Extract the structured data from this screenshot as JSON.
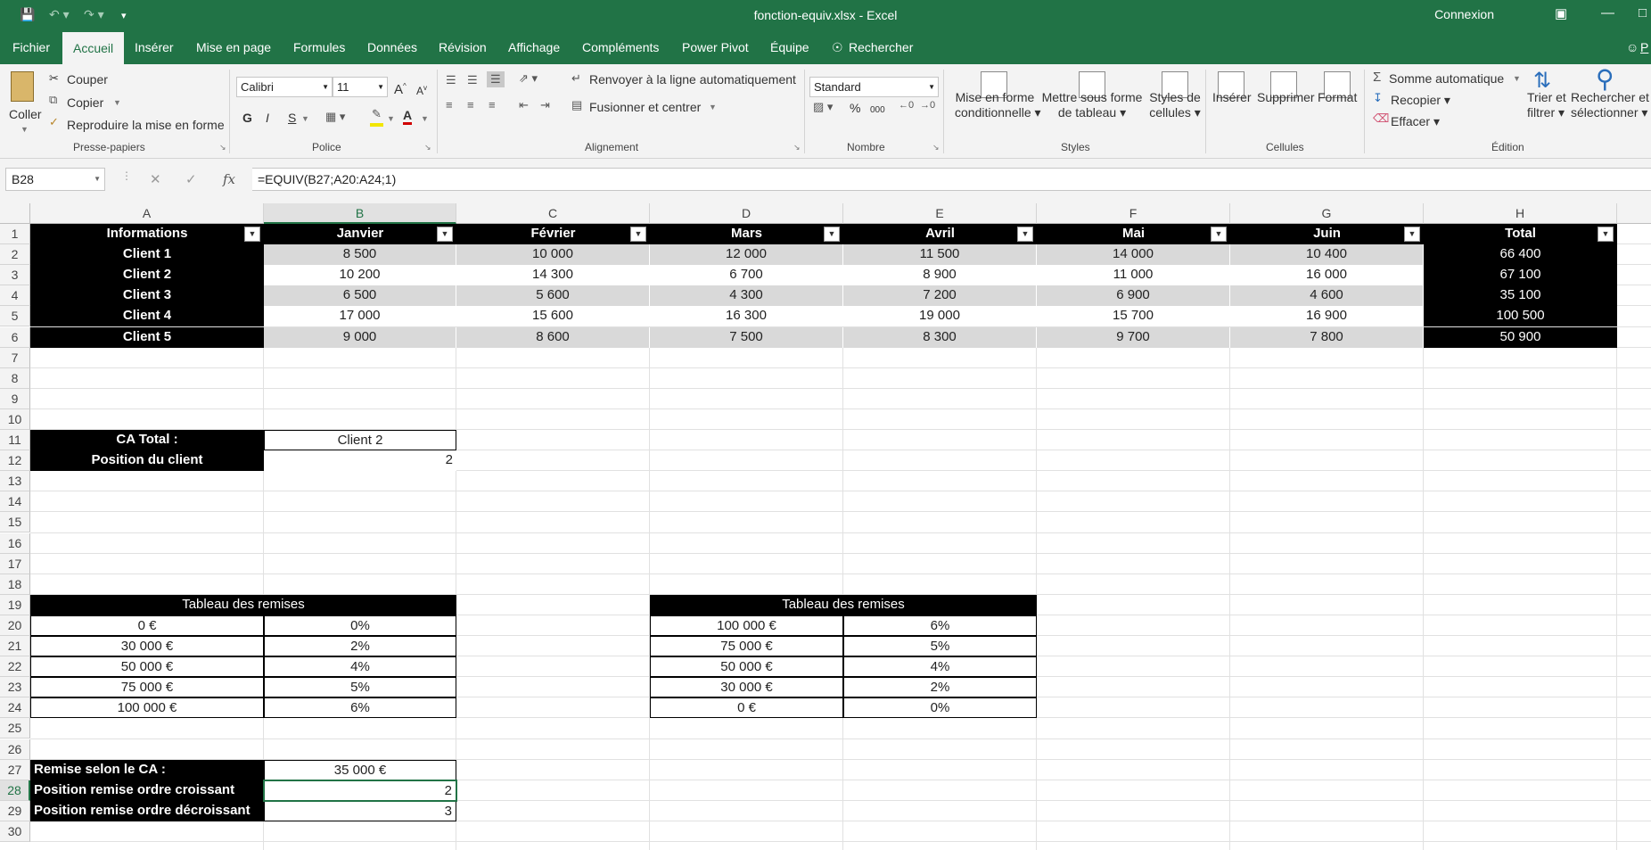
{
  "window": {
    "title": "fonction-equiv.xlsx  -  Excel",
    "signin": "Connexion"
  },
  "menu": {
    "items": [
      "Fichier",
      "Accueil",
      "Insérer",
      "Mise en page",
      "Formules",
      "Données",
      "Révision",
      "Affichage",
      "Compléments",
      "Power Pivot",
      "Équipe",
      "Rechercher"
    ],
    "active": "Accueil",
    "share": "P"
  },
  "ribbon": {
    "clipboard": {
      "paste": "Coller",
      "cut": "Couper",
      "copy": "Copier",
      "format_painter": "Reproduire la mise en forme",
      "label": "Presse-papiers"
    },
    "font": {
      "name": "Calibri",
      "size": "11",
      "label": "Police",
      "grow": "A",
      "shrink": "A",
      "bold": "G",
      "italic": "I",
      "underline": "S",
      "color": "A"
    },
    "alignment": {
      "wrap": "Renvoyer à la ligne automatiquement",
      "merge": "Fusionner et centrer",
      "label": "Alignement"
    },
    "number": {
      "format": "Standard",
      "label": "Nombre",
      "percent": "%",
      "thousands": "000"
    },
    "styles": {
      "cond_l1": "Mise en forme",
      "cond_l2": "conditionnelle",
      "table_l1": "Mettre sous forme",
      "table_l2": "de tableau",
      "cell_l1": "Styles de",
      "cell_l2": "cellules",
      "label": "Styles"
    },
    "cells": {
      "insert": "Insérer",
      "delete": "Supprimer",
      "format": "Format",
      "label": "Cellules"
    },
    "editing": {
      "autosum": "Somme automatique",
      "fill": "Recopier",
      "clear": "Effacer",
      "sort_l1": "Trier et",
      "sort_l2": "filtrer",
      "find_l1": "Rechercher et",
      "find_l2": "sélectionner",
      "label": "Édition"
    }
  },
  "formula_bar": {
    "name_box": "B28",
    "formula": "=EQUIV(B27;A20:A24;1)",
    "fx": "fx"
  },
  "columns": [
    "A",
    "B",
    "C",
    "D",
    "E",
    "F",
    "G",
    "H"
  ],
  "rows": [
    "1",
    "2",
    "3",
    "4",
    "5",
    "6",
    "7",
    "8",
    "9",
    "10",
    "11",
    "12",
    "13",
    "14",
    "15",
    "16",
    "17",
    "18",
    "19",
    "20",
    "21",
    "22",
    "23",
    "24",
    "25",
    "26",
    "27",
    "28",
    "29",
    "30"
  ],
  "selected_cell": {
    "column": "B",
    "row": "28"
  },
  "sales_table": {
    "headers": [
      "Informations",
      "Janvier",
      "Février",
      "Mars",
      "Avril",
      "Mai",
      "Juin",
      "Total"
    ],
    "rows": [
      [
        "Client 1",
        "8 500",
        "10 000",
        "12 000",
        "11 500",
        "14 000",
        "10 400",
        "66 400"
      ],
      [
        "Client 2",
        "10 200",
        "14 300",
        "6 700",
        "8 900",
        "11 000",
        "16 000",
        "67 100"
      ],
      [
        "Client 3",
        "6 500",
        "5 600",
        "4 300",
        "7 200",
        "6 900",
        "4 600",
        "35 100"
      ],
      [
        "Client 4",
        "17 000",
        "15 600",
        "16 300",
        "19 000",
        "15 700",
        "16 900",
        "100 500"
      ],
      [
        "Client 5",
        "9 000",
        "8 600",
        "7 500",
        "8 300",
        "9 700",
        "7 800",
        "50 900"
      ]
    ]
  },
  "lookup": {
    "ca_label": "CA Total :",
    "ca_value": "Client 2",
    "pos_label": "Position du client",
    "pos_value": "2"
  },
  "discount_asc": {
    "title": "Tableau des remises",
    "rows": [
      [
        "0 €",
        "0%"
      ],
      [
        "30 000 €",
        "2%"
      ],
      [
        "50 000 €",
        "4%"
      ],
      [
        "75 000 €",
        "5%"
      ],
      [
        "100 000 €",
        "6%"
      ]
    ]
  },
  "discount_desc": {
    "title": "Tableau des remises",
    "rows": [
      [
        "100 000 €",
        "6%"
      ],
      [
        "75 000 €",
        "5%"
      ],
      [
        "50 000 €",
        "4%"
      ],
      [
        "30 000 €",
        "2%"
      ],
      [
        "0 €",
        "0%"
      ]
    ]
  },
  "remise": {
    "label": "Remise selon le CA  :",
    "value": "35 000 €",
    "asc_label": "Position remise ordre croissant",
    "asc_value": "2",
    "desc_label": "Position remise ordre décroissant",
    "desc_value": "3"
  }
}
